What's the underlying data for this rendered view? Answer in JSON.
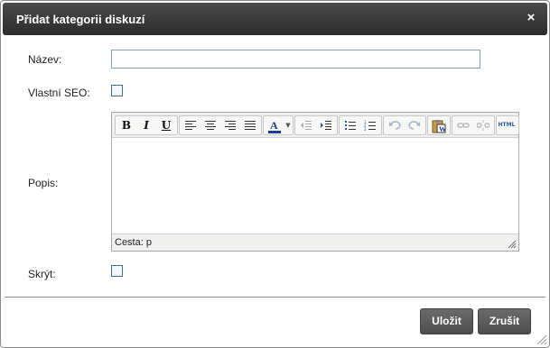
{
  "dialog": {
    "title": "Přidat kategorii diskuzí",
    "close_symbol": "×"
  },
  "form": {
    "name_label": "Název:",
    "name_value": "",
    "seo_label": "Vlastní SEO:",
    "seo_checked": false,
    "description_label": "Popis:",
    "hide_label": "Skrýt:",
    "hide_checked": false
  },
  "editor": {
    "toolbar": {
      "bold": "B",
      "italic": "I",
      "underline": "U",
      "icons": [
        "bold-icon",
        "italic-icon",
        "underline-icon",
        "align-left-icon",
        "align-center-icon",
        "align-right-icon",
        "align-justify-icon",
        "font-color-icon",
        "outdent-icon",
        "indent-icon",
        "bullet-list-icon",
        "numbered-list-icon",
        "undo-icon",
        "redo-icon",
        "paste-word-icon",
        "link-icon",
        "unlink-icon",
        "html-source-icon"
      ],
      "html_label": "HTML"
    },
    "status_path": "Cesta: p"
  },
  "buttons": {
    "save": "Uložit",
    "cancel": "Zrušit"
  },
  "colors": {
    "titlebar": "#333333",
    "button": "#5a5a5a",
    "checkbox_border": "#3d6d9f",
    "input_border": "#7fa2b8"
  }
}
